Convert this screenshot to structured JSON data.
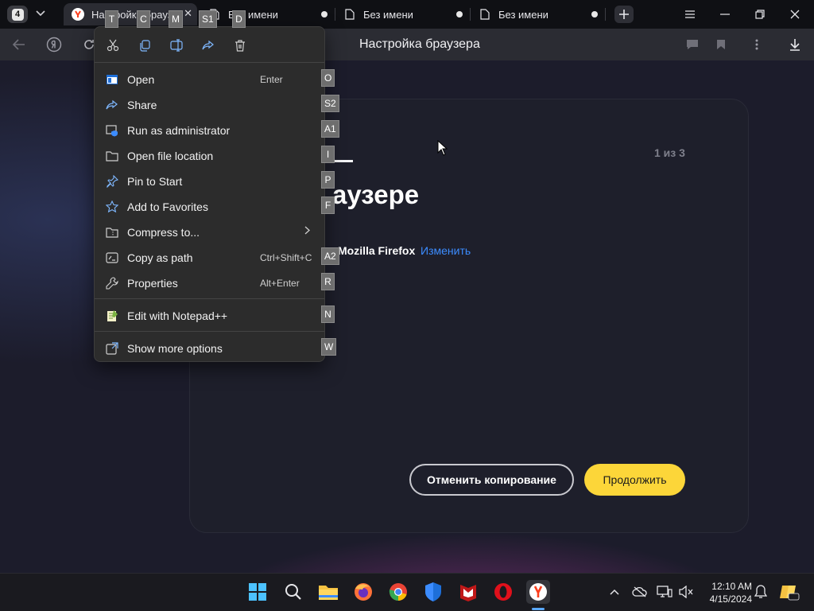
{
  "browser": {
    "tab_count": "4",
    "tabs": [
      {
        "title": "Настройка браузера",
        "active": true
      },
      {
        "title": "Без имени",
        "active": false
      },
      {
        "title": "Без имени",
        "active": false
      },
      {
        "title": "Без имени",
        "active": false
      }
    ],
    "page_title": "Настройка браузера"
  },
  "dialog": {
    "step": "1 из 3",
    "heading": "аузере",
    "source_browser": "Mozilla Firefox",
    "change_link": "Изменить",
    "cancel_button": "Отменить копирование",
    "continue_button": "Продолжить"
  },
  "context_menu": {
    "quick_actions": [
      {
        "icon": "cut-icon",
        "key": "T"
      },
      {
        "icon": "copy-icon",
        "key": "C"
      },
      {
        "icon": "rename-icon",
        "key": "M"
      },
      {
        "icon": "share-icon",
        "key": "S1"
      },
      {
        "icon": "delete-icon",
        "key": "D"
      }
    ],
    "items": [
      {
        "label": "Open",
        "shortcut": "Enter",
        "key": "O",
        "icon": "open-icon"
      },
      {
        "label": "Share",
        "shortcut": "",
        "key": "S2",
        "icon": "share-icon"
      },
      {
        "label": "Run as administrator",
        "shortcut": "",
        "key": "A1",
        "icon": "admin-shield-icon"
      },
      {
        "label": "Open file location",
        "shortcut": "",
        "key": "I",
        "icon": "folder-icon"
      },
      {
        "label": "Pin to Start",
        "shortcut": "",
        "key": "P",
        "icon": "pin-icon"
      },
      {
        "label": "Add to Favorites",
        "shortcut": "",
        "key": "F",
        "icon": "star-icon"
      },
      {
        "label": "Compress to...",
        "shortcut": "",
        "key": "",
        "icon": "archive-icon",
        "submenu": true
      },
      {
        "label": "Copy as path",
        "shortcut": "Ctrl+Shift+C",
        "key": "A2",
        "icon": "copy-path-icon"
      },
      {
        "label": "Properties",
        "shortcut": "Alt+Enter",
        "key": "R",
        "icon": "wrench-icon"
      },
      {
        "label": "Edit with Notepad++",
        "shortcut": "",
        "key": "N",
        "icon": "notepad-plus-icon"
      },
      {
        "label": "Show more options",
        "shortcut": "",
        "key": "W",
        "icon": "more-options-icon"
      }
    ]
  },
  "taskbar": {
    "apps": [
      "start-icon",
      "search-icon",
      "file-explorer-icon",
      "firefox-icon",
      "chrome-icon",
      "defender-icon",
      "mcafee-icon",
      "opera-icon",
      "yandex-browser-icon"
    ],
    "clock_time": "12:10 AM",
    "clock_date": "4/15/2024"
  },
  "colors": {
    "accent_yellow": "#fcd639",
    "link_blue": "#3c8cff",
    "menu_bg": "#2c2c2c"
  }
}
